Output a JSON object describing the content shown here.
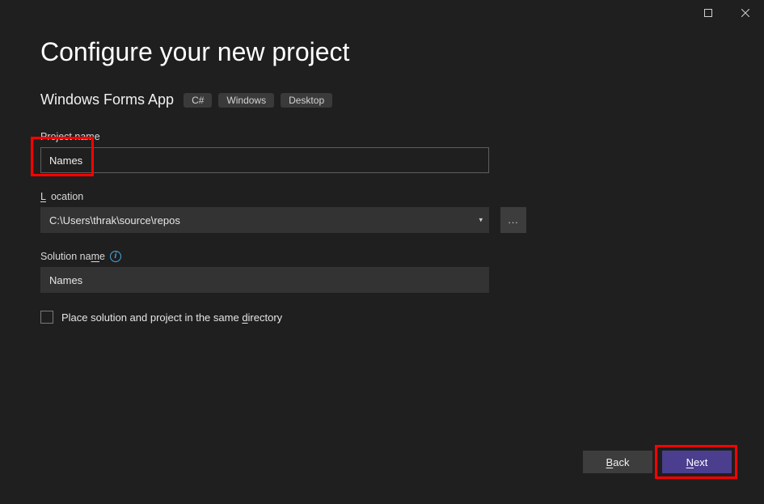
{
  "window": {
    "title": "Configure your new project"
  },
  "template": {
    "name": "Windows Forms App",
    "tags": [
      "C#",
      "Windows",
      "Desktop"
    ]
  },
  "fields": {
    "project_name_label_pre": "",
    "project_name_label": "Project name",
    "project_name": "Names",
    "location_label": "Location",
    "location_value": "C:\\Users\\thrak\\source\\repos",
    "browse_label": "...",
    "solution_name_label_pre": "Solution na",
    "solution_name_label_acc": "m",
    "solution_name_label_post": "e",
    "solution_name": "Names",
    "directory_checkbox_pre": "Place solution and project in the same ",
    "directory_checkbox_acc": "d",
    "directory_checkbox_post": "irectory",
    "directory_checked": false
  },
  "footer": {
    "back_acc": "B",
    "back_post": "ack",
    "next_acc": "N",
    "next_post": "ext"
  }
}
